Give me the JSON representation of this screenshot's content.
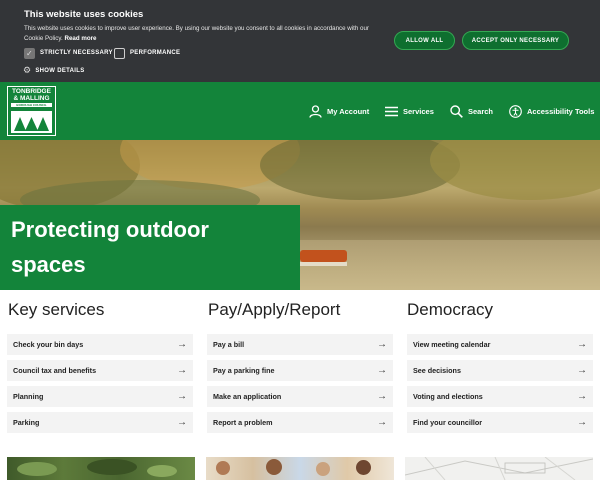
{
  "cookie": {
    "title": "This website uses cookies",
    "text": "This website uses cookies to improve user experience. By using our website you consent to all cookies in accordance with our Cookie Policy.",
    "read_more": "Read more",
    "strictly_necessary": "STRICTLY NECESSARY",
    "performance": "PERFORMANCE",
    "show_details": "SHOW DETAILS",
    "allow_all": "ALLOW ALL",
    "accept_necessary": "ACCEPT ONLY NECESSARY",
    "strictly_checked": true,
    "performance_checked": false
  },
  "header": {
    "logo_line1": "TONBRIDGE",
    "logo_line2": "& MALLING",
    "logo_line3": "BOROUGH COUNCIL",
    "nav": [
      {
        "label": "My Account",
        "icon": "user-icon"
      },
      {
        "label": "Services",
        "icon": "menu-icon"
      },
      {
        "label": "Search",
        "icon": "search-icon"
      },
      {
        "label": "Accessibility Tools",
        "icon": "accessibility-icon"
      }
    ]
  },
  "hero": {
    "title_line1": "Protecting outdoor",
    "title_line2": "spaces"
  },
  "sections": [
    {
      "title": "Key services",
      "links": [
        "Check your bin days",
        "Council tax and benefits",
        "Planning",
        "Parking"
      ]
    },
    {
      "title": "Pay/Apply/Report",
      "links": [
        "Pay a bill",
        "Pay a parking fine",
        "Make an application",
        "Report a problem"
      ]
    },
    {
      "title": "Democracy",
      "links": [
        "View meeting calendar",
        "See decisions",
        "Voting and elections",
        "Find your councillor"
      ]
    }
  ],
  "colors": {
    "brand_green": "#13843a",
    "cookie_bar": "#333538",
    "link_bg": "#f3f3f3"
  }
}
